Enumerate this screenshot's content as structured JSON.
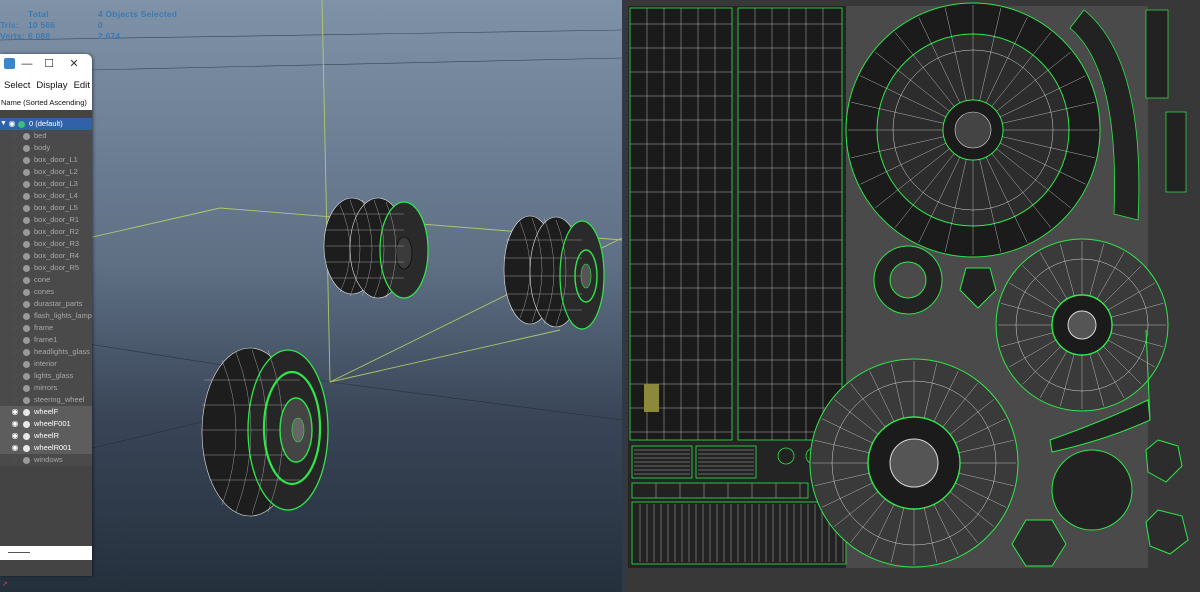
{
  "hud": {
    "total_label": "Total",
    "selected_label": "4 Objects Selected",
    "tris_label": "Tris:",
    "tris_total": "10 566",
    "tris_selected": "0",
    "verts_label": "Verts:",
    "verts_total": "6 088",
    "verts_selected": "2 674"
  },
  "outliner": {
    "window_buttons": {
      "minimize": "—",
      "maximize": "☐",
      "close": "✕"
    },
    "menu": [
      "Select",
      "Display",
      "Edit"
    ],
    "header": "Name (Sorted Ascending)",
    "default_layer": "0 (default)",
    "items": [
      {
        "label": "bed",
        "selected": false
      },
      {
        "label": "body",
        "selected": false
      },
      {
        "label": "box_door_L1",
        "selected": false
      },
      {
        "label": "box_door_L2",
        "selected": false
      },
      {
        "label": "box_door_L3",
        "selected": false
      },
      {
        "label": "box_door_L4",
        "selected": false
      },
      {
        "label": "box_door_L5",
        "selected": false
      },
      {
        "label": "box_door_R1",
        "selected": false
      },
      {
        "label": "box_door_R2",
        "selected": false
      },
      {
        "label": "box_door_R3",
        "selected": false
      },
      {
        "label": "box_door_R4",
        "selected": false
      },
      {
        "label": "box_door_R5",
        "selected": false
      },
      {
        "label": "cone",
        "selected": false
      },
      {
        "label": "cones",
        "selected": false
      },
      {
        "label": "durastar_parts",
        "selected": false
      },
      {
        "label": "flash_lights_lamp",
        "selected": false
      },
      {
        "label": "frame",
        "selected": false
      },
      {
        "label": "frame1",
        "selected": false
      },
      {
        "label": "headlights_glass",
        "selected": false
      },
      {
        "label": "interior",
        "selected": false
      },
      {
        "label": "lights_glass",
        "selected": false
      },
      {
        "label": "mirrors",
        "selected": false
      },
      {
        "label": "steering_wheel",
        "selected": false
      },
      {
        "label": "wheelF",
        "selected": true
      },
      {
        "label": "wheelF001",
        "selected": true
      },
      {
        "label": "wheelR",
        "selected": true
      },
      {
        "label": "wheelR001",
        "selected": true
      },
      {
        "label": "windows",
        "selected": false
      }
    ]
  },
  "icons": {
    "eye": "eye-icon",
    "object": "object-dot-icon",
    "layer": "layer-icon"
  },
  "colors": {
    "hud_text": "#3d7ab2",
    "wire_green": "#2ee84a",
    "selection_blue": "#2f62a8",
    "uv_highlight": "#8c8a3a"
  }
}
